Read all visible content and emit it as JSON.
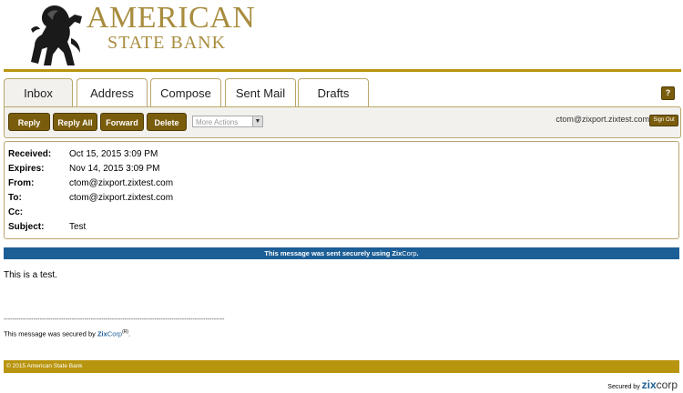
{
  "brand": {
    "line1": "AMERICAN",
    "line2": "STATE BANK",
    "color": "#a88c3e"
  },
  "tabs": [
    {
      "label": "Inbox",
      "active": true
    },
    {
      "label": "Address",
      "active": false
    },
    {
      "label": "Compose",
      "active": false
    },
    {
      "label": "Sent Mail",
      "active": false
    },
    {
      "label": "Drafts",
      "active": false
    }
  ],
  "help_label": "?",
  "toolbar": {
    "reply": "Reply",
    "reply_all": "Reply All",
    "forward": "Forward",
    "delete": "Delete",
    "more_actions": "More Actions",
    "user_email": "ctom@zixport.zixtest.com",
    "sign_out": "Sign Out"
  },
  "message": {
    "received_label": "Received:",
    "received": "Oct 15, 2015 3:09 PM",
    "expires_label": "Expires:",
    "expires": "Nov 14, 2015 3:09 PM",
    "from_label": "From:",
    "from": "ctom@zixport.zixtest.com",
    "to_label": "To:",
    "to": "ctom@zixport.zixtest.com",
    "cc_label": "Cc:",
    "cc": "",
    "subject_label": "Subject:",
    "subject": "Test",
    "body": "This is a test."
  },
  "secure_bar": {
    "prefix": "This message was sent securely using ",
    "zix": "Zix",
    "corp": "Corp",
    "suffix": "."
  },
  "signature": {
    "line": "--------------------------------------------------------------------------------------------------------",
    "prefix": "This message was secured by ",
    "zix": "Zix",
    "corp": "Corp",
    "reg": "(R)",
    "suffix": "."
  },
  "footer": {
    "copyright": "© 2015 American State Bank",
    "secured_by": "Secured by ",
    "zix": "zix",
    "corp": "corp"
  },
  "colors": {
    "gold": "#b8950e",
    "button": "#7a5d0c",
    "secure_blue": "#1c5e96"
  }
}
